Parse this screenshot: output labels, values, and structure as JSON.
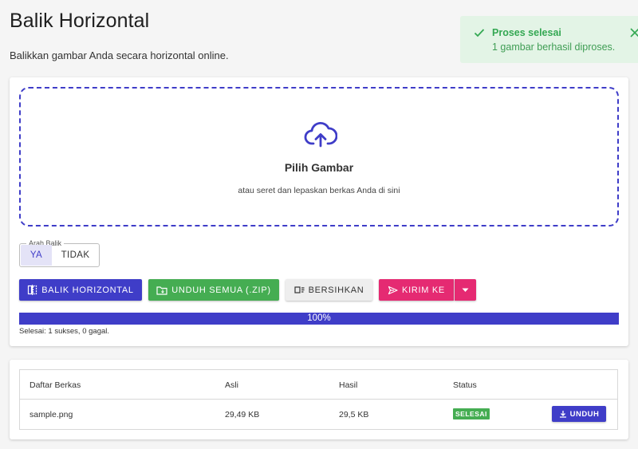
{
  "header": {
    "title": "Balik Horizontal",
    "subtitle": "Balikkan gambar Anda secara horizontal online."
  },
  "toast": {
    "title": "Proses selesai",
    "message": "1 gambar berhasil diproses.",
    "icon": "check-icon",
    "close_icon": "close-icon",
    "color": "#34a853"
  },
  "dropzone": {
    "icon": "cloud-upload-icon",
    "title": "Pilih Gambar",
    "hint": "atau seret dan lepaskan berkas Anda di sini"
  },
  "direction": {
    "legend": "Arah Balik",
    "options": [
      "YA",
      "TIDAK"
    ],
    "selected": "YA"
  },
  "actions": {
    "flip_label": "BALIK HORIZONTAL",
    "zip_label": "UNDUH SEMUA (.ZIP)",
    "clear_label": "BERSIHKAN",
    "send_label": "KIRIM KE"
  },
  "progress": {
    "value": 100,
    "label": "100%",
    "summary": "Selesai: 1 sukses, 0 gagal."
  },
  "files": {
    "columns": [
      "Daftar Berkas",
      "Asli",
      "Hasil",
      "Status"
    ],
    "rows": [
      {
        "name": "sample.png",
        "original": "29,49 KB",
        "result": "29,5 KB",
        "status": "SELESAI",
        "download_label": "UNDUH"
      }
    ]
  },
  "colors": {
    "primary": "#3f3dc8",
    "success": "#45ad52",
    "accent": "#e52a72"
  }
}
